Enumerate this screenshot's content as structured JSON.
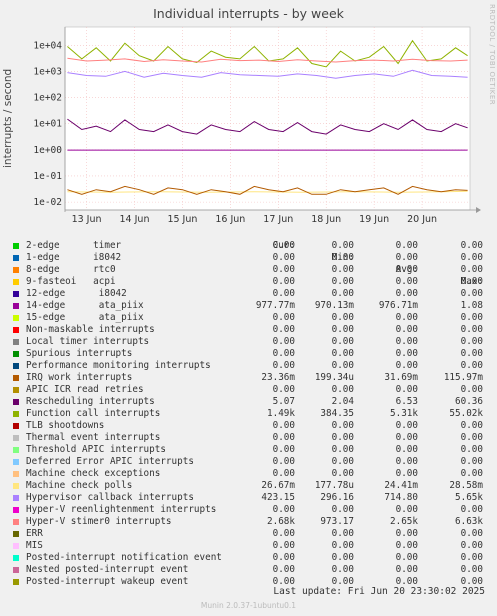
{
  "title": "Individual interrupts - by week",
  "side_text": "RRDTOOL / TOBI OETIKER",
  "ylabel": "interrupts / second",
  "header": {
    "cur": "Cur:",
    "min": "Min:",
    "avg": "Avg:",
    "max": "Max:"
  },
  "legend": [
    {
      "name": "2-edge      timer",
      "color": "#00cc00",
      "cur": "0.00",
      "min": "0.00",
      "avg": "0.00",
      "max": "0.00"
    },
    {
      "name": "1-edge      i8042",
      "color": "#0066b3",
      "cur": "0.00",
      "min": "0.00",
      "avg": "0.00",
      "max": "0.00"
    },
    {
      "name": "8-edge      rtc0",
      "color": "#ff8000",
      "cur": "0.00",
      "min": "0.00",
      "avg": "0.00",
      "max": "0.00"
    },
    {
      "name": "9-fasteoi   acpi",
      "color": "#ffcc00",
      "cur": "0.00",
      "min": "0.00",
      "avg": "0.00",
      "max": "0.00"
    },
    {
      "name": "12-edge      i8042",
      "color": "#330099",
      "cur": "0.00",
      "min": "0.00",
      "avg": "0.00",
      "max": "0.00"
    },
    {
      "name": "14-edge      ata_piix",
      "color": "#990099",
      "cur": "977.77m",
      "min": "970.13m",
      "avg": "976.71m",
      "max": "1.08"
    },
    {
      "name": "15-edge      ata_piix",
      "color": "#ccff00",
      "cur": "0.00",
      "min": "0.00",
      "avg": "0.00",
      "max": "0.00"
    },
    {
      "name": "Non-maskable interrupts",
      "color": "#ff0000",
      "cur": "0.00",
      "min": "0.00",
      "avg": "0.00",
      "max": "0.00"
    },
    {
      "name": "Local timer interrupts",
      "color": "#808080",
      "cur": "0.00",
      "min": "0.00",
      "avg": "0.00",
      "max": "0.00"
    },
    {
      "name": "Spurious interrupts",
      "color": "#008f00",
      "cur": "0.00",
      "min": "0.00",
      "avg": "0.00",
      "max": "0.00"
    },
    {
      "name": "Performance monitoring interrupts",
      "color": "#00487d",
      "cur": "0.00",
      "min": "0.00",
      "avg": "0.00",
      "max": "0.00"
    },
    {
      "name": "IRQ work interrupts",
      "color": "#b35a00",
      "cur": "23.36m",
      "min": "199.34u",
      "avg": "31.69m",
      "max": "115.97m"
    },
    {
      "name": "APIC ICR read retries",
      "color": "#b38f00",
      "cur": "0.00",
      "min": "0.00",
      "avg": "0.00",
      "max": "0.00"
    },
    {
      "name": "Rescheduling interrupts",
      "color": "#6b006b",
      "cur": "5.07",
      "min": "2.04",
      "avg": "6.53",
      "max": "60.36"
    },
    {
      "name": "Function call interrupts",
      "color": "#8fb300",
      "cur": "1.49k",
      "min": "384.35",
      "avg": "5.31k",
      "max": "55.02k"
    },
    {
      "name": "TLB shootdowns",
      "color": "#b30000",
      "cur": "0.00",
      "min": "0.00",
      "avg": "0.00",
      "max": "0.00"
    },
    {
      "name": "Thermal event interrupts",
      "color": "#bebebe",
      "cur": "0.00",
      "min": "0.00",
      "avg": "0.00",
      "max": "0.00"
    },
    {
      "name": "Threshold APIC interrupts",
      "color": "#80ff80",
      "cur": "0.00",
      "min": "0.00",
      "avg": "0.00",
      "max": "0.00"
    },
    {
      "name": "Deferred Error APIC interrupts",
      "color": "#80c9ff",
      "cur": "0.00",
      "min": "0.00",
      "avg": "0.00",
      "max": "0.00"
    },
    {
      "name": "Machine check exceptions",
      "color": "#ffc080",
      "cur": "0.00",
      "min": "0.00",
      "avg": "0.00",
      "max": "0.00"
    },
    {
      "name": "Machine check polls",
      "color": "#ffe680",
      "cur": "26.67m",
      "min": "177.78u",
      "avg": "24.41m",
      "max": "28.58m"
    },
    {
      "name": "Hypervisor callback interrupts",
      "color": "#aa80ff",
      "cur": "423.15",
      "min": "296.16",
      "avg": "714.80",
      "max": "5.65k"
    },
    {
      "name": "Hyper-V reenlightenment interrupts",
      "color": "#ee00cc",
      "cur": "0.00",
      "min": "0.00",
      "avg": "0.00",
      "max": "0.00"
    },
    {
      "name": "Hyper-V stimer0 interrupts",
      "color": "#ff8080",
      "cur": "2.68k",
      "min": "973.17",
      "avg": "2.65k",
      "max": "6.63k"
    },
    {
      "name": "ERR",
      "color": "#666600",
      "cur": "0.00",
      "min": "0.00",
      "avg": "0.00",
      "max": "0.00"
    },
    {
      "name": "MIS",
      "color": "#ffbfff",
      "cur": "0.00",
      "min": "0.00",
      "avg": "0.00",
      "max": "0.00"
    },
    {
      "name": "Posted-interrupt notification event",
      "color": "#00ffcc",
      "cur": "0.00",
      "min": "0.00",
      "avg": "0.00",
      "max": "0.00"
    },
    {
      "name": "Nested posted-interrupt event",
      "color": "#cc6699",
      "cur": "0.00",
      "min": "0.00",
      "avg": "0.00",
      "max": "0.00"
    },
    {
      "name": "Posted-interrupt wakeup event",
      "color": "#999900",
      "cur": "0.00",
      "min": "0.00",
      "avg": "0.00",
      "max": "0.00"
    }
  ],
  "last_update": "Last update: Fri Jun 20 23:30:02 2025",
  "footer": "Munin 2.0.37-1ubuntu0.1",
  "chart_data": {
    "type": "line",
    "title": "Individual interrupts - by week",
    "ylabel": "interrupts / second",
    "yscale": "log",
    "ylim": [
      0.005,
      50000
    ],
    "yticks": [
      {
        "label": "1e+04",
        "value": 10000
      },
      {
        "label": "1e+03",
        "value": 1000
      },
      {
        "label": "1e+02",
        "value": 100
      },
      {
        "label": "1e+01",
        "value": 10
      },
      {
        "label": "1e+00",
        "value": 1
      },
      {
        "label": "1e-01",
        "value": 0.1
      },
      {
        "label": "1e-02",
        "value": 0.01
      }
    ],
    "xlim": [
      12.55,
      21.0
    ],
    "xticks": [
      {
        "label": "13 Jun",
        "value": 13
      },
      {
        "label": "14 Jun",
        "value": 14
      },
      {
        "label": "15 Jun",
        "value": 15
      },
      {
        "label": "16 Jun",
        "value": 16
      },
      {
        "label": "17 Jun",
        "value": 17
      },
      {
        "label": "18 Jun",
        "value": 18
      },
      {
        "label": "19 Jun",
        "value": 19
      },
      {
        "label": "20 Jun",
        "value": 20
      }
    ],
    "grid": true,
    "series": [
      {
        "name": "Function call interrupts",
        "color": "#8fb300",
        "x": [
          12.6,
          12.9,
          13.2,
          13.5,
          13.8,
          14.1,
          14.4,
          14.7,
          15.0,
          15.3,
          15.6,
          15.9,
          16.2,
          16.5,
          16.8,
          17.1,
          17.4,
          17.7,
          18.0,
          18.3,
          18.6,
          18.9,
          19.2,
          19.5,
          19.8,
          20.1,
          20.4,
          20.7,
          20.95
        ],
        "y": [
          9000,
          3000,
          8000,
          2500,
          12000,
          4000,
          2500,
          9000,
          3000,
          2200,
          6000,
          3500,
          3000,
          9000,
          2500,
          3000,
          8000,
          2000,
          1500,
          6000,
          2500,
          3500,
          9000,
          2000,
          15000,
          2500,
          3000,
          8000,
          4000
        ]
      },
      {
        "name": "Hyper-V stimer0 interrupts",
        "color": "#ff8080",
        "x": [
          12.6,
          13.0,
          13.4,
          13.8,
          14.2,
          14.6,
          15.0,
          15.4,
          15.8,
          16.2,
          16.6,
          17.0,
          17.4,
          17.8,
          18.2,
          18.6,
          19.0,
          19.4,
          19.8,
          20.2,
          20.6,
          20.95
        ],
        "y": [
          3200,
          2500,
          2700,
          3000,
          2400,
          2800,
          2500,
          2300,
          2900,
          2600,
          2700,
          2400,
          2800,
          2500,
          2300,
          2600,
          2700,
          2500,
          2900,
          2600,
          2500,
          2700
        ]
      },
      {
        "name": "Hypervisor callback interrupts",
        "color": "#aa80ff",
        "x": [
          12.6,
          13.0,
          13.4,
          13.8,
          14.2,
          14.6,
          15.0,
          15.4,
          15.8,
          16.2,
          16.6,
          17.0,
          17.4,
          17.8,
          18.2,
          18.6,
          19.0,
          19.4,
          19.8,
          20.2,
          20.6,
          20.95
        ],
        "y": [
          900,
          700,
          650,
          1000,
          600,
          850,
          700,
          600,
          900,
          750,
          700,
          650,
          800,
          700,
          550,
          700,
          800,
          650,
          1100,
          700,
          650,
          600
        ]
      },
      {
        "name": "Rescheduling interrupts",
        "color": "#6b006b",
        "x": [
          12.6,
          12.9,
          13.2,
          13.5,
          13.8,
          14.1,
          14.4,
          14.7,
          15.0,
          15.3,
          15.6,
          15.9,
          16.2,
          16.5,
          16.8,
          17.1,
          17.4,
          17.7,
          18.0,
          18.3,
          18.6,
          18.9,
          19.2,
          19.5,
          19.8,
          20.1,
          20.4,
          20.7,
          20.95
        ],
        "y": [
          15,
          6,
          8,
          5,
          14,
          6,
          5,
          9,
          5,
          4,
          9,
          6,
          5,
          12,
          6,
          5,
          11,
          5,
          4,
          9,
          6,
          5,
          10,
          6,
          14,
          6,
          5,
          10,
          7
        ]
      },
      {
        "name": "14-edge      ata_piix",
        "color": "#990099",
        "x": [
          12.6,
          20.95
        ],
        "y": [
          0.98,
          0.98
        ]
      },
      {
        "name": "Machine check polls",
        "color": "#ffe680",
        "x": [
          12.6,
          13.5,
          14.5,
          15.5,
          16.5,
          17.5,
          18.5,
          19.5,
          20.5,
          20.95
        ],
        "y": [
          0.025,
          0.024,
          0.025,
          0.024,
          0.025,
          0.024,
          0.025,
          0.024,
          0.025,
          0.026
        ]
      },
      {
        "name": "IRQ work interrupts",
        "color": "#b35a00",
        "x": [
          12.6,
          12.9,
          13.2,
          13.5,
          13.8,
          14.1,
          14.4,
          14.7,
          15.0,
          15.3,
          15.6,
          15.9,
          16.2,
          16.5,
          16.8,
          17.1,
          17.4,
          17.7,
          18.0,
          18.3,
          18.6,
          18.9,
          19.2,
          19.5,
          19.8,
          20.1,
          20.4,
          20.7,
          20.95
        ],
        "y": [
          0.03,
          0.02,
          0.03,
          0.025,
          0.04,
          0.03,
          0.02,
          0.035,
          0.03,
          0.02,
          0.03,
          0.025,
          0.02,
          0.04,
          0.03,
          0.025,
          0.035,
          0.02,
          0.02,
          0.03,
          0.025,
          0.03,
          0.035,
          0.02,
          0.04,
          0.03,
          0.025,
          0.03,
          0.028
        ]
      }
    ]
  }
}
